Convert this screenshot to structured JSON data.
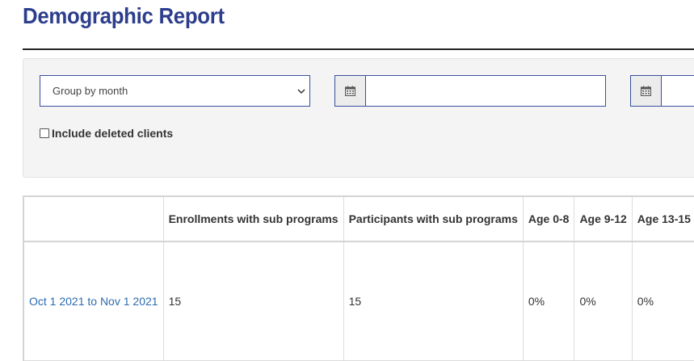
{
  "page": {
    "title": "Demographic Report"
  },
  "filters": {
    "group_by": {
      "selected": "Group by month"
    },
    "start_date": {
      "value": ""
    },
    "end_date": {
      "value": ""
    },
    "include_deleted": {
      "label": "Include deleted clients",
      "checked": false
    }
  },
  "table": {
    "columns": [
      "",
      "Enrollments with sub programs",
      "Participants with sub programs",
      "Age 0-8",
      "Age 9-12",
      "Age 13-15"
    ],
    "rows": [
      {
        "period": "Oct 1 2021 to Nov 1 2021",
        "enrollments": "15",
        "participants": "15",
        "age_0_8": "0%",
        "age_9_12": "0%",
        "age_13_15": "0%"
      }
    ]
  },
  "icons": {
    "calendar": "calendar-icon",
    "chevron": "chevron-down-icon"
  },
  "colors": {
    "title": "#2c3e8c",
    "link": "#2c6ab0",
    "input_border": "#3a4ea0",
    "panel_bg": "#f4f4f4"
  }
}
